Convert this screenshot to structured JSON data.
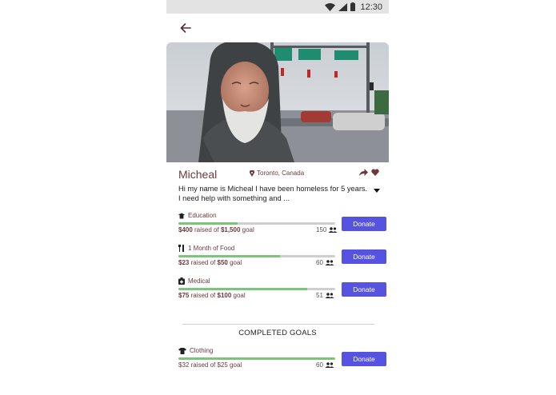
{
  "status_bar": {
    "time": "12:30"
  },
  "profile": {
    "name": "Micheal",
    "location": "Toronto, Canada",
    "bio": "Hi my name is Micheal I have been homeless for 5 years. I need help with something and ..."
  },
  "goals": [
    {
      "label": "Education",
      "raised": "$400",
      "raised_text": " raised of ",
      "goal": "$1,500",
      "goal_text": " goal",
      "count": "150",
      "donate": "Donate",
      "progress": 0.38,
      "icon": "graduation-cap-icon"
    },
    {
      "label": "1 Month of Food",
      "raised": "$23",
      "raised_text": " raised of ",
      "goal": "$50",
      "goal_text": " goal",
      "count": "60",
      "donate": "Donate",
      "progress": 0.65,
      "icon": "fork-knife-icon"
    },
    {
      "label": "Medical",
      "raised": "$75",
      "raised_text": " raised of ",
      "goal": "$100",
      "goal_text": " goal",
      "count": "51",
      "donate": "Donate",
      "progress": 0.82,
      "icon": "medical-kit-icon"
    }
  ],
  "completed": {
    "title": "COMPLETED GOALS",
    "goals": [
      {
        "label": "Clothing",
        "raised_line": "$32 raised of $25 goal",
        "count": "60",
        "donate": "Donate",
        "progress": 1.0,
        "icon": "tshirt-icon"
      }
    ]
  },
  "colors": {
    "accent": "#5553e0",
    "progress": "#7cc47a",
    "name": "#6b3a3f"
  }
}
